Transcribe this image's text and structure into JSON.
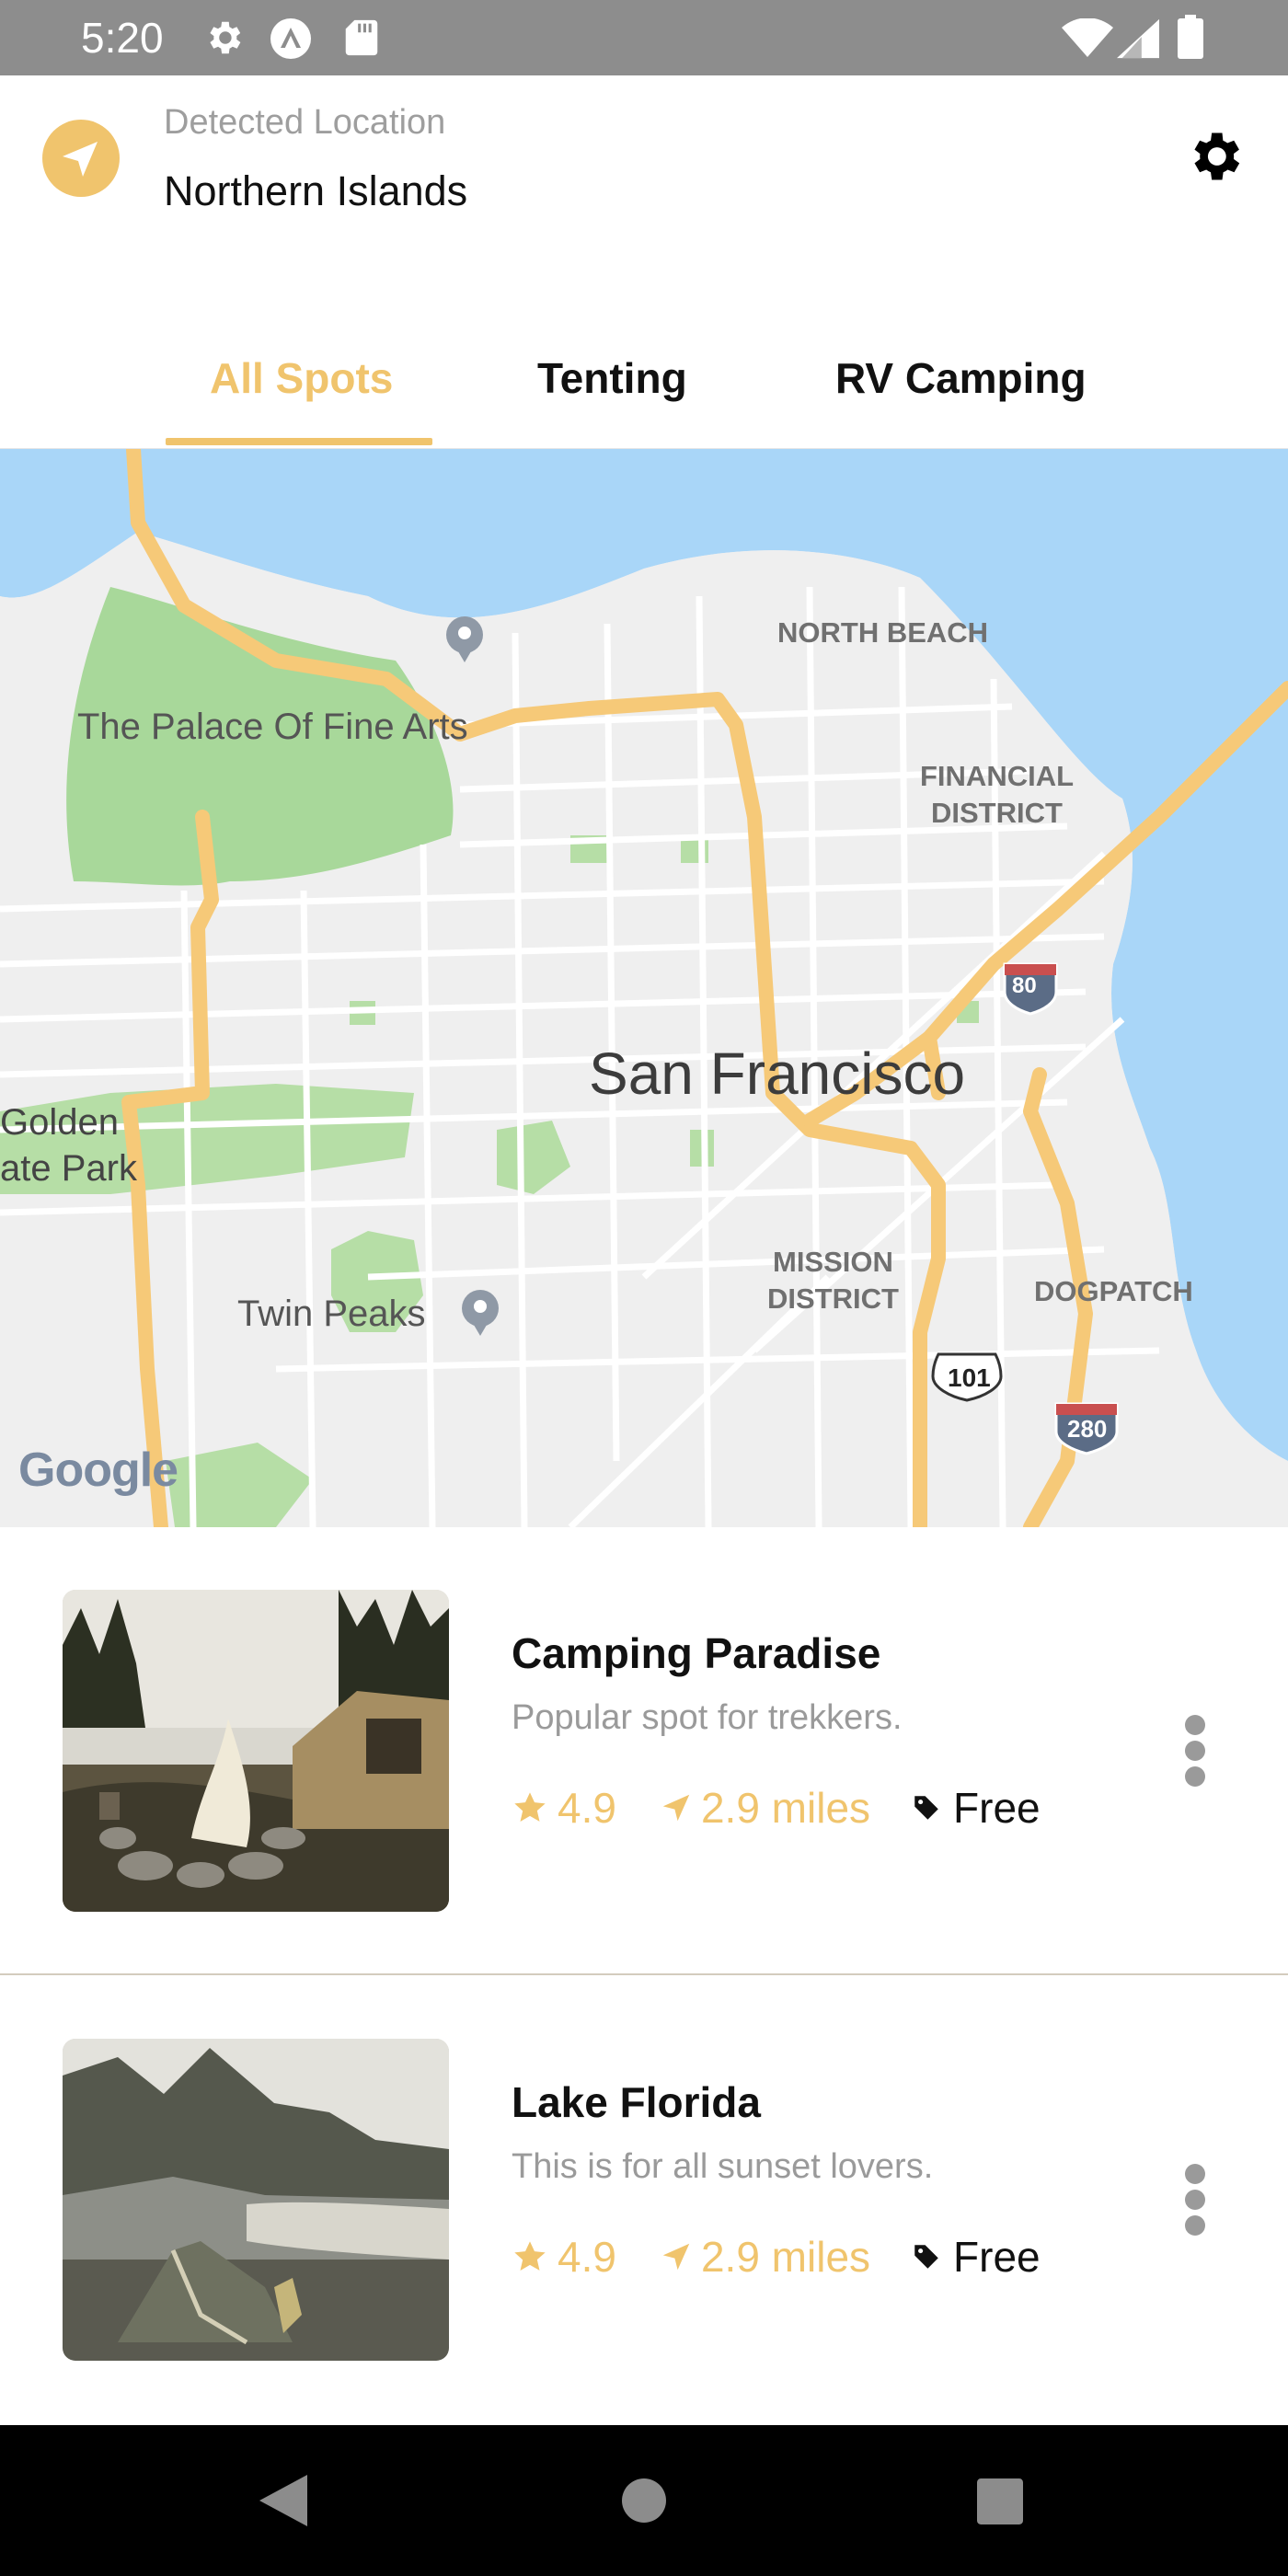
{
  "status_bar": {
    "time": "5:20",
    "icons": [
      "gear-icon",
      "app-icon",
      "sd-card-icon",
      "wifi-icon",
      "signal-icon",
      "battery-icon"
    ]
  },
  "header": {
    "detected_label": "Detected Location",
    "location": "Northern Islands",
    "icons": {
      "location": "navigation-arrow-icon",
      "settings": "gear-icon"
    }
  },
  "tabs": [
    {
      "label": "All Spots",
      "active": true
    },
    {
      "label": "Tenting",
      "active": false
    },
    {
      "label": "RV Camping",
      "active": false
    }
  ],
  "map": {
    "labels": {
      "north_beach": "NORTH BEACH",
      "palace": "The Palace Of Fine Arts",
      "financial_1": "FINANCIAL",
      "financial_2": "DISTRICT",
      "city": "San Francisco",
      "golden_1": "Golden",
      "golden_2": "ate Park",
      "twin_peaks": "Twin Peaks",
      "mission_1": "MISSION",
      "mission_2": "DISTRICT",
      "dogpatch": "DOGPATCH",
      "shield_80": "80",
      "shield_101": "101",
      "shield_280": "280",
      "google": "Google"
    }
  },
  "spots": [
    {
      "name": "Camping Paradise",
      "description": "Popular spot for trekkers.",
      "rating": "4.9",
      "distance": "2.9 miles",
      "price": "Free"
    },
    {
      "name": "Lake Florida",
      "description": "This is for all sunset lovers.",
      "rating": "4.9",
      "distance": "2.9 miles",
      "price": "Free"
    }
  ],
  "colors": {
    "accent": "#f0c46d",
    "status_bar": "#8d8d8d",
    "water": "#a9d6f8",
    "park": "#a8d89a"
  }
}
